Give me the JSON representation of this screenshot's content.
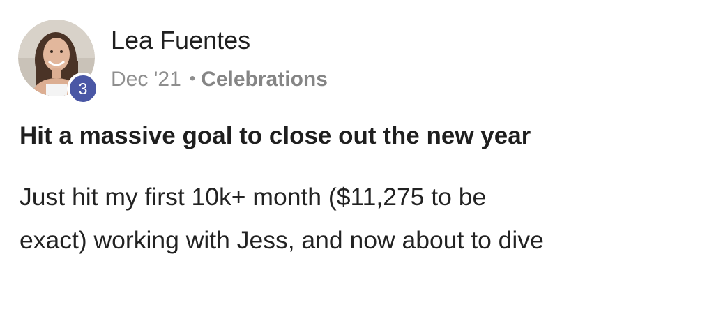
{
  "post": {
    "author": {
      "name": "Lea Fuentes",
      "level": "3"
    },
    "date": "Dec '21",
    "separator": "•",
    "category": "Celebrations",
    "title": "Hit a massive goal to close out the new year",
    "body_lines": [
      "Just hit my first 10k+ month ($11,275 to be",
      "exact) working with Jess, and now about to dive"
    ]
  },
  "colors": {
    "level_badge": "#4a57a5",
    "meta_text": "#8e8e8e"
  },
  "icons": {
    "avatar": "user-photo-avatar"
  }
}
